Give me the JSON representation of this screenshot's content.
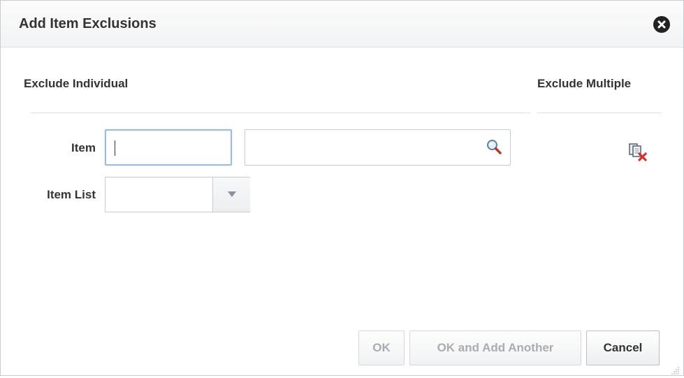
{
  "dialog": {
    "title": "Add Item Exclusions",
    "close_icon": "close-circle-icon"
  },
  "exclude_individual": {
    "heading": "Exclude Individual",
    "item": {
      "label": "Item",
      "value": "",
      "description_value": "",
      "search_icon": "magnifier-icon"
    },
    "item_list": {
      "label": "Item List",
      "selected": "",
      "dropdown_icon": "triangle-down-icon"
    }
  },
  "exclude_multiple": {
    "heading": "Exclude Multiple",
    "icon": "exclude-multiple-icon"
  },
  "buttons": {
    "ok": "OK",
    "ok_and_add_another": "OK and Add Another",
    "cancel": "Cancel"
  },
  "colors": {
    "focus_border": "#9bbce0",
    "disabled_text": "#a7adb3",
    "delete_red": "#d0342c"
  }
}
